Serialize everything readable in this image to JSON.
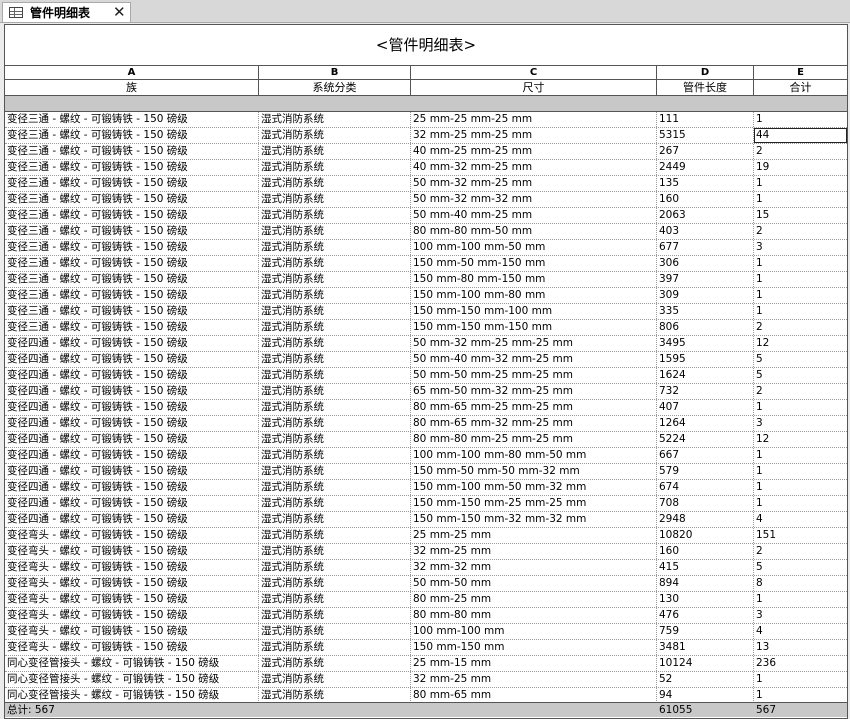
{
  "tab": {
    "title": "管件明细表",
    "close_label": "✕"
  },
  "schedule": {
    "title": "<管件明细表>",
    "column_letters": [
      "A",
      "B",
      "C",
      "D",
      "E"
    ],
    "headers": [
      "族",
      "系统分类",
      "尺寸",
      "管件长度",
      "合计"
    ],
    "selected_row": 1,
    "rows": [
      [
        "变径三通 - 螺纹 - 可锻铸铁 - 150 磅级",
        "湿式消防系统",
        "25 mm-25 mm-25 mm",
        "111",
        "1"
      ],
      [
        "变径三通 - 螺纹 - 可锻铸铁 - 150 磅级",
        "湿式消防系统",
        "32 mm-25 mm-25 mm",
        "5315",
        "44"
      ],
      [
        "变径三通 - 螺纹 - 可锻铸铁 - 150 磅级",
        "湿式消防系统",
        "40 mm-25 mm-25 mm",
        "267",
        "2"
      ],
      [
        "变径三通 - 螺纹 - 可锻铸铁 - 150 磅级",
        "湿式消防系统",
        "40 mm-32 mm-25 mm",
        "2449",
        "19"
      ],
      [
        "变径三通 - 螺纹 - 可锻铸铁 - 150 磅级",
        "湿式消防系统",
        "50 mm-32 mm-25 mm",
        "135",
        "1"
      ],
      [
        "变径三通 - 螺纹 - 可锻铸铁 - 150 磅级",
        "湿式消防系统",
        "50 mm-32 mm-32 mm",
        "160",
        "1"
      ],
      [
        "变径三通 - 螺纹 - 可锻铸铁 - 150 磅级",
        "湿式消防系统",
        "50 mm-40 mm-25 mm",
        "2063",
        "15"
      ],
      [
        "变径三通 - 螺纹 - 可锻铸铁 - 150 磅级",
        "湿式消防系统",
        "80 mm-80 mm-50 mm",
        "403",
        "2"
      ],
      [
        "变径三通 - 螺纹 - 可锻铸铁 - 150 磅级",
        "湿式消防系统",
        "100 mm-100 mm-50 mm",
        "677",
        "3"
      ],
      [
        "变径三通 - 螺纹 - 可锻铸铁 - 150 磅级",
        "湿式消防系统",
        "150 mm-50 mm-150 mm",
        "306",
        "1"
      ],
      [
        "变径三通 - 螺纹 - 可锻铸铁 - 150 磅级",
        "湿式消防系统",
        "150 mm-80 mm-150 mm",
        "397",
        "1"
      ],
      [
        "变径三通 - 螺纹 - 可锻铸铁 - 150 磅级",
        "湿式消防系统",
        "150 mm-100 mm-80 mm",
        "309",
        "1"
      ],
      [
        "变径三通 - 螺纹 - 可锻铸铁 - 150 磅级",
        "湿式消防系统",
        "150 mm-150 mm-100 mm",
        "335",
        "1"
      ],
      [
        "变径三通 - 螺纹 - 可锻铸铁 - 150 磅级",
        "湿式消防系统",
        "150 mm-150 mm-150 mm",
        "806",
        "2"
      ],
      [
        "变径四通 - 螺纹 - 可锻铸铁 - 150 磅级",
        "湿式消防系统",
        "50 mm-32 mm-25 mm-25 mm",
        "3495",
        "12"
      ],
      [
        "变径四通 - 螺纹 - 可锻铸铁 - 150 磅级",
        "湿式消防系统",
        "50 mm-40 mm-32 mm-25 mm",
        "1595",
        "5"
      ],
      [
        "变径四通 - 螺纹 - 可锻铸铁 - 150 磅级",
        "湿式消防系统",
        "50 mm-50 mm-25 mm-25 mm",
        "1624",
        "5"
      ],
      [
        "变径四通 - 螺纹 - 可锻铸铁 - 150 磅级",
        "湿式消防系统",
        "65 mm-50 mm-32 mm-25 mm",
        "732",
        "2"
      ],
      [
        "变径四通 - 螺纹 - 可锻铸铁 - 150 磅级",
        "湿式消防系统",
        "80 mm-65 mm-25 mm-25 mm",
        "407",
        "1"
      ],
      [
        "变径四通 - 螺纹 - 可锻铸铁 - 150 磅级",
        "湿式消防系统",
        "80 mm-65 mm-32 mm-25 mm",
        "1264",
        "3"
      ],
      [
        "变径四通 - 螺纹 - 可锻铸铁 - 150 磅级",
        "湿式消防系统",
        "80 mm-80 mm-25 mm-25 mm",
        "5224",
        "12"
      ],
      [
        "变径四通 - 螺纹 - 可锻铸铁 - 150 磅级",
        "湿式消防系统",
        "100 mm-100 mm-80 mm-50 mm",
        "667",
        "1"
      ],
      [
        "变径四通 - 螺纹 - 可锻铸铁 - 150 磅级",
        "湿式消防系统",
        "150 mm-50 mm-50 mm-32 mm",
        "579",
        "1"
      ],
      [
        "变径四通 - 螺纹 - 可锻铸铁 - 150 磅级",
        "湿式消防系统",
        "150 mm-100 mm-50 mm-32 mm",
        "674",
        "1"
      ],
      [
        "变径四通 - 螺纹 - 可锻铸铁 - 150 磅级",
        "湿式消防系统",
        "150 mm-150 mm-25 mm-25 mm",
        "708",
        "1"
      ],
      [
        "变径四通 - 螺纹 - 可锻铸铁 - 150 磅级",
        "湿式消防系统",
        "150 mm-150 mm-32 mm-32 mm",
        "2948",
        "4"
      ],
      [
        "变径弯头 - 螺纹 - 可锻铸铁 - 150 磅级",
        "湿式消防系统",
        "25 mm-25 mm",
        "10820",
        "151"
      ],
      [
        "变径弯头 - 螺纹 - 可锻铸铁 - 150 磅级",
        "湿式消防系统",
        "32 mm-25 mm",
        "160",
        "2"
      ],
      [
        "变径弯头 - 螺纹 - 可锻铸铁 - 150 磅级",
        "湿式消防系统",
        "32 mm-32 mm",
        "415",
        "5"
      ],
      [
        "变径弯头 - 螺纹 - 可锻铸铁 - 150 磅级",
        "湿式消防系统",
        "50 mm-50 mm",
        "894",
        "8"
      ],
      [
        "变径弯头 - 螺纹 - 可锻铸铁 - 150 磅级",
        "湿式消防系统",
        "80 mm-25 mm",
        "130",
        "1"
      ],
      [
        "变径弯头 - 螺纹 - 可锻铸铁 - 150 磅级",
        "湿式消防系统",
        "80 mm-80 mm",
        "476",
        "3"
      ],
      [
        "变径弯头 - 螺纹 - 可锻铸铁 - 150 磅级",
        "湿式消防系统",
        "100 mm-100 mm",
        "759",
        "4"
      ],
      [
        "变径弯头 - 螺纹 - 可锻铸铁 - 150 磅级",
        "湿式消防系统",
        "150 mm-150 mm",
        "3481",
        "13"
      ],
      [
        "同心变径管接头 - 螺纹 - 可锻铸铁 - 150 磅级",
        "湿式消防系统",
        "25 mm-15 mm",
        "10124",
        "236"
      ],
      [
        "同心变径管接头 - 螺纹 - 可锻铸铁 - 150 磅级",
        "湿式消防系统",
        "32 mm-25 mm",
        "52",
        "1"
      ],
      [
        "同心变径管接头 - 螺纹 - 可锻铸铁 - 150 磅级",
        "湿式消防系统",
        "80 mm-65 mm",
        "94",
        "1"
      ]
    ],
    "footer": {
      "total_label": "总计: 567",
      "length_total": "61055",
      "count_total": "567"
    }
  }
}
